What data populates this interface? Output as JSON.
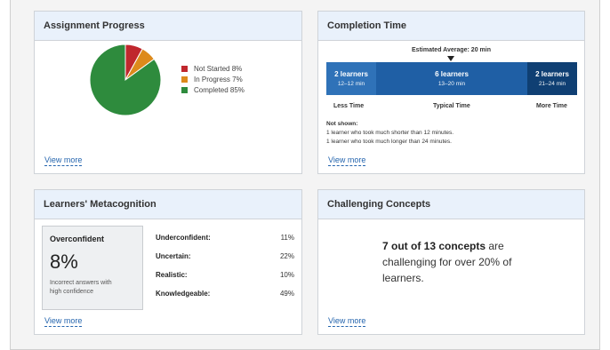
{
  "progress": {
    "title": "Assignment Progress",
    "legend": [
      {
        "label": "Not Started 8%",
        "color": "#c0272d"
      },
      {
        "label": "In Progress 7%",
        "color": "#dd8a1c"
      },
      {
        "label": "Completed 85%",
        "color": "#2e8b3d"
      }
    ],
    "slices_pct": [
      8,
      7,
      85
    ],
    "view_more": "View more"
  },
  "time": {
    "title": "Completion Time",
    "estimated": "Estimated Average: 20 min",
    "bars": [
      {
        "count": "2 learners",
        "range": "12–12 min",
        "color": "#2f72b8"
      },
      {
        "count": "6 learners",
        "range": "13–20 min",
        "color": "#1f5fa5"
      },
      {
        "count": "2 learners",
        "range": "21–24 min",
        "color": "#0f3f73"
      }
    ],
    "labels": [
      "Less Time",
      "Typical Time",
      "More Time"
    ],
    "not_shown_title": "Not shown:",
    "not_shown_1": "1 learner who took much shorter than 12 minutes.",
    "not_shown_2": "1 learner who took much longer than 24 minutes.",
    "view_more": "View more"
  },
  "meta": {
    "title": "Learners' Metacognition",
    "highlight": {
      "title": "Overconfident",
      "pct": "8%",
      "desc_1": "Incorrect answers with",
      "desc_2": "high confidence"
    },
    "rows": [
      {
        "label": "Underconfident:",
        "value": "11%"
      },
      {
        "label": "Uncertain:",
        "value": "22%"
      },
      {
        "label": "Realistic:",
        "value": "10%"
      },
      {
        "label": "Knowledgeable:",
        "value": "49%"
      }
    ],
    "view_more": "View more"
  },
  "challenging": {
    "title": "Challenging Concepts",
    "bold": "7 out of 13 concepts",
    "rest": " are challenging for over 20% of learners.",
    "view_more": "View more"
  }
}
